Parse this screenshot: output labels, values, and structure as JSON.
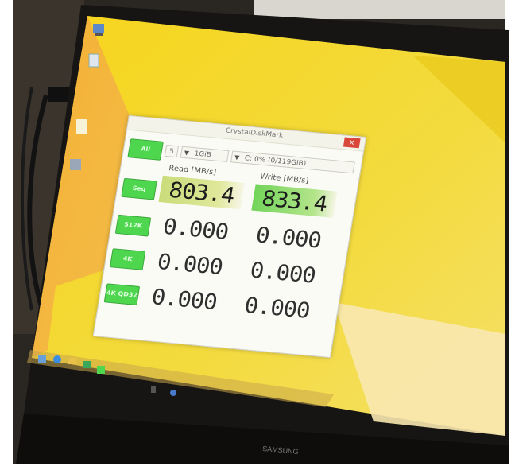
{
  "window": {
    "title": "CrystalDiskMark",
    "close_label": "x"
  },
  "controls": {
    "all_label": "All",
    "runs_value": "5",
    "size_value": "1GiB",
    "drive_value": "C: 0% (0/119GiB)"
  },
  "columns": {
    "read": "Read [MB/s]",
    "write": "Write [MB/s]"
  },
  "rows": [
    {
      "label": "Seq",
      "read": "803.4",
      "write": "833.4"
    },
    {
      "label": "512K",
      "read": "0.000",
      "write": "0.000"
    },
    {
      "label": "4K",
      "read": "0.000",
      "write": "0.000"
    },
    {
      "label": "4K QD32",
      "read": "0.000",
      "write": "0.000"
    }
  ],
  "monitor": {
    "brand": "SAMSUNG"
  },
  "icons": {
    "desktop": [
      "computer-icon",
      "recycle-bin-icon",
      "folder-icon",
      "app-icon"
    ],
    "taskbar": [
      "start-icon",
      "ie-icon",
      "explorer-icon",
      "store-icon",
      "app-icon"
    ],
    "tray": [
      "network-icon",
      "volume-icon"
    ]
  },
  "colors": {
    "wallpaper": "#f1d224",
    "button_green": "#4fd64f",
    "close_red": "#d9473b"
  }
}
